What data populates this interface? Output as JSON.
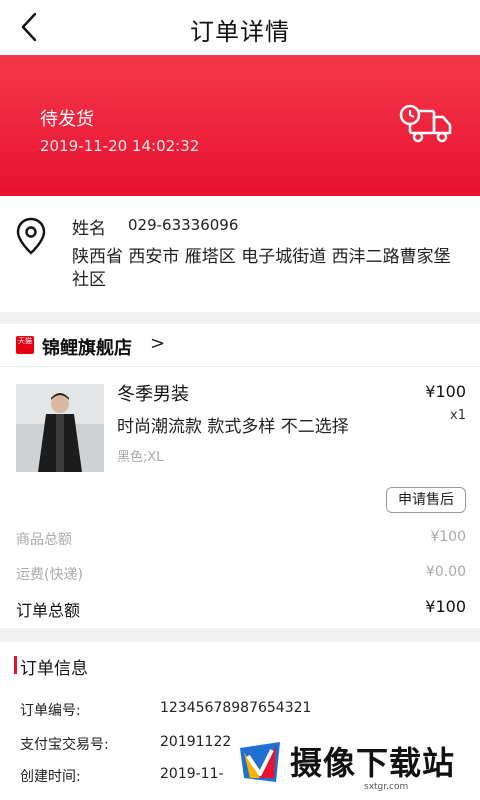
{
  "header": {
    "title": "订单详情"
  },
  "status": {
    "label": "待发货",
    "time": "2019-11-20 14:02:32"
  },
  "address": {
    "name": "姓名",
    "phone": "029-63336096",
    "detail": "陕西省 西安市 雁塔区 电子城街道 西沣二路曹家堡社区"
  },
  "store": {
    "badge": "天猫",
    "name": "锦鲤旗舰店",
    "chevron": ">"
  },
  "product": {
    "title": "冬季男装",
    "desc": "时尚潮流款 款式多样  不二选择",
    "spec": "黑色;XL",
    "price": "¥100",
    "qty": "x1",
    "after_sale": "申请售后"
  },
  "summary": {
    "goods_label": "商品总额",
    "goods_value": "¥100",
    "shipping_label": "运费(快递)",
    "shipping_value": "¥0.00",
    "total_label": "订单总额",
    "total_value": "¥100"
  },
  "order_info": {
    "title": "订单信息",
    "rows": [
      {
        "label": "订单编号:",
        "value": "12345678987654321"
      },
      {
        "label": "支付宝交易号:",
        "value": "20191122"
      },
      {
        "label": "创建时间:",
        "value": "2019-11-"
      }
    ]
  },
  "watermark": {
    "text": "摄像下载站",
    "url": "sxtgr.com"
  },
  "colors": {
    "accent": "#e8112f",
    "banner_top": "#f3384c"
  }
}
